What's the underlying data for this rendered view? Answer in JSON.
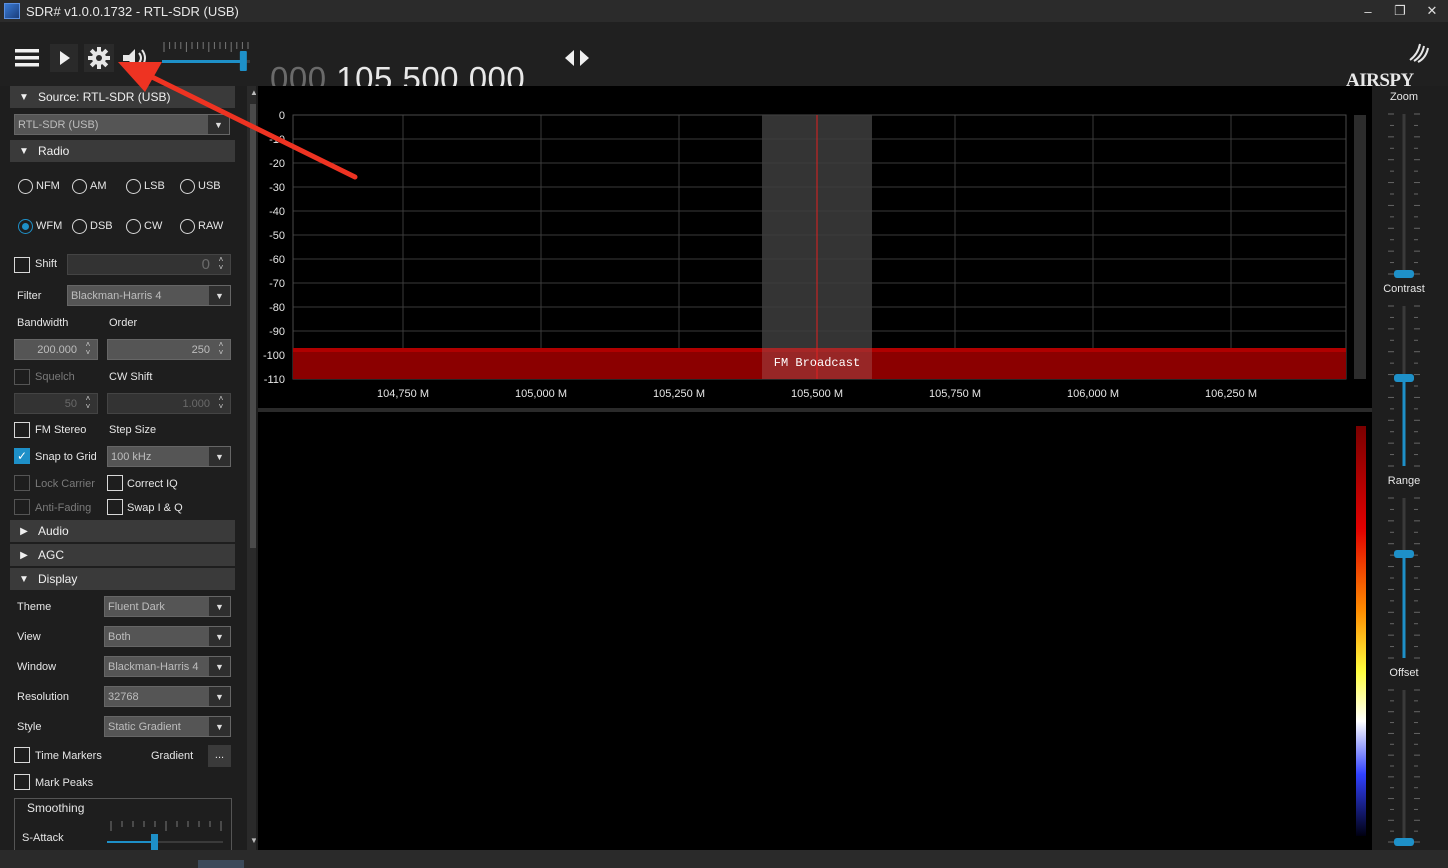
{
  "window": {
    "title": "SDR# v1.0.0.1732 - RTL-SDR (USB)",
    "minimize": "–",
    "restore": "❐",
    "close": "✕"
  },
  "toolbar": {
    "menu_icon": "hamburger-icon",
    "play_icon": "play-icon",
    "settings_icon": "gear-icon",
    "audio_icon": "speaker-icon",
    "volume": 0.93,
    "frequency_dim": "000.",
    "frequency_bright": "105.500.000",
    "tune_icon": "left-right-arrows-icon",
    "logo": "AIRSPY"
  },
  "source": {
    "header": "Source: RTL-SDR (USB)",
    "device": "RTL-SDR (USB)"
  },
  "radio": {
    "header": "Radio",
    "modes": [
      "NFM",
      "AM",
      "LSB",
      "USB",
      "WFM",
      "DSB",
      "CW",
      "RAW"
    ],
    "selected_mode": "WFM",
    "shift_label": "Shift",
    "shift_value": "0",
    "filter_label": "Filter",
    "filter_value": "Blackman-Harris 4",
    "bandwidth_label": "Bandwidth",
    "order_label": "Order",
    "bandwidth_value": "200.000",
    "order_value": "250",
    "squelch_label": "Squelch",
    "cw_shift_label": "CW Shift",
    "squelch_value": "50",
    "cw_shift_value": "1.000",
    "fm_stereo_label": "FM Stereo",
    "step_size_label": "Step Size",
    "snap_label": "Snap to Grid",
    "step_size_value": "100 kHz",
    "lock_carrier_label": "Lock Carrier",
    "correct_iq_label": "Correct IQ",
    "anti_fading_label": "Anti-Fading",
    "swap_iq_label": "Swap I & Q"
  },
  "collapsed": {
    "audio": "Audio",
    "agc": "AGC"
  },
  "display": {
    "header": "Display",
    "theme_label": "Theme",
    "theme_value": "Fluent Dark",
    "view_label": "View",
    "view_value": "Both",
    "window_label": "Window",
    "window_value": "Blackman-Harris 4",
    "resolution_label": "Resolution",
    "resolution_value": "32768",
    "style_label": "Style",
    "style_value": "Static Gradient",
    "time_markers_label": "Time Markers",
    "gradient_label": "Gradient",
    "gradient_button": "...",
    "mark_peaks_label": "Mark Peaks",
    "smoothing_label": "Smoothing",
    "s_attack_label": "S-Attack"
  },
  "spectrum": {
    "y_ticks": [
      "0",
      "-10",
      "-20",
      "-30",
      "-40",
      "-50",
      "-60",
      "-70",
      "-80",
      "-90",
      "-100",
      "-110"
    ],
    "x_ticks": [
      "104,750 M",
      "105,000 M",
      "105,250 M",
      "105,500 M",
      "105,750 M",
      "106,000 M",
      "106,250 M"
    ],
    "band_label": "FM Broadcast"
  },
  "right_panel": {
    "zoom": "Zoom",
    "contrast": "Contrast",
    "range": "Range",
    "offset": "Offset"
  },
  "colors": {
    "accent": "#1e90c8",
    "band": "#8b0000"
  }
}
